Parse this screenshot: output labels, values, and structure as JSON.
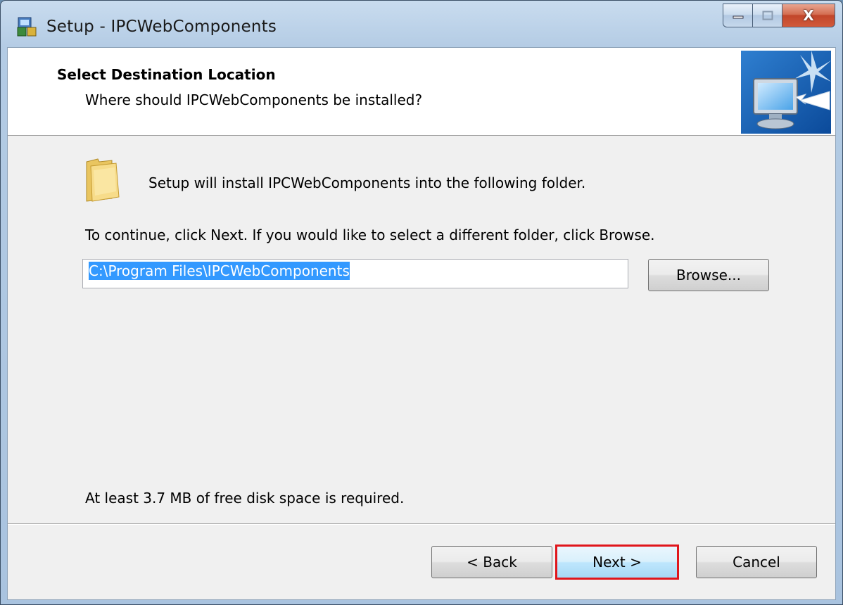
{
  "window": {
    "title": "Setup - IPCWebComponents",
    "close_glyph": "X"
  },
  "header": {
    "title": "Select Destination Location",
    "subtitle": "Where should IPCWebComponents be installed?"
  },
  "main": {
    "install_text": "Setup will install IPCWebComponents into the following folder.",
    "continue_text": "To continue, click Next. If you would like to select a different folder, click Browse.",
    "path_value": "C:\\Program Files\\IPCWebComponents",
    "browse_label": "Browse...",
    "disk_space_text": "At least 3.7 MB of free disk space is required."
  },
  "footer": {
    "back_label": "< Back",
    "next_label": "Next >",
    "cancel_label": "Cancel"
  },
  "colors": {
    "selection": "#3399ff",
    "highlight_border": "#e0161c",
    "close_button": "#c7502f"
  },
  "icons": [
    "setup-app-icon",
    "minimize-icon",
    "maximize-icon",
    "close-icon",
    "computer-install-icon",
    "folder-icon"
  ]
}
